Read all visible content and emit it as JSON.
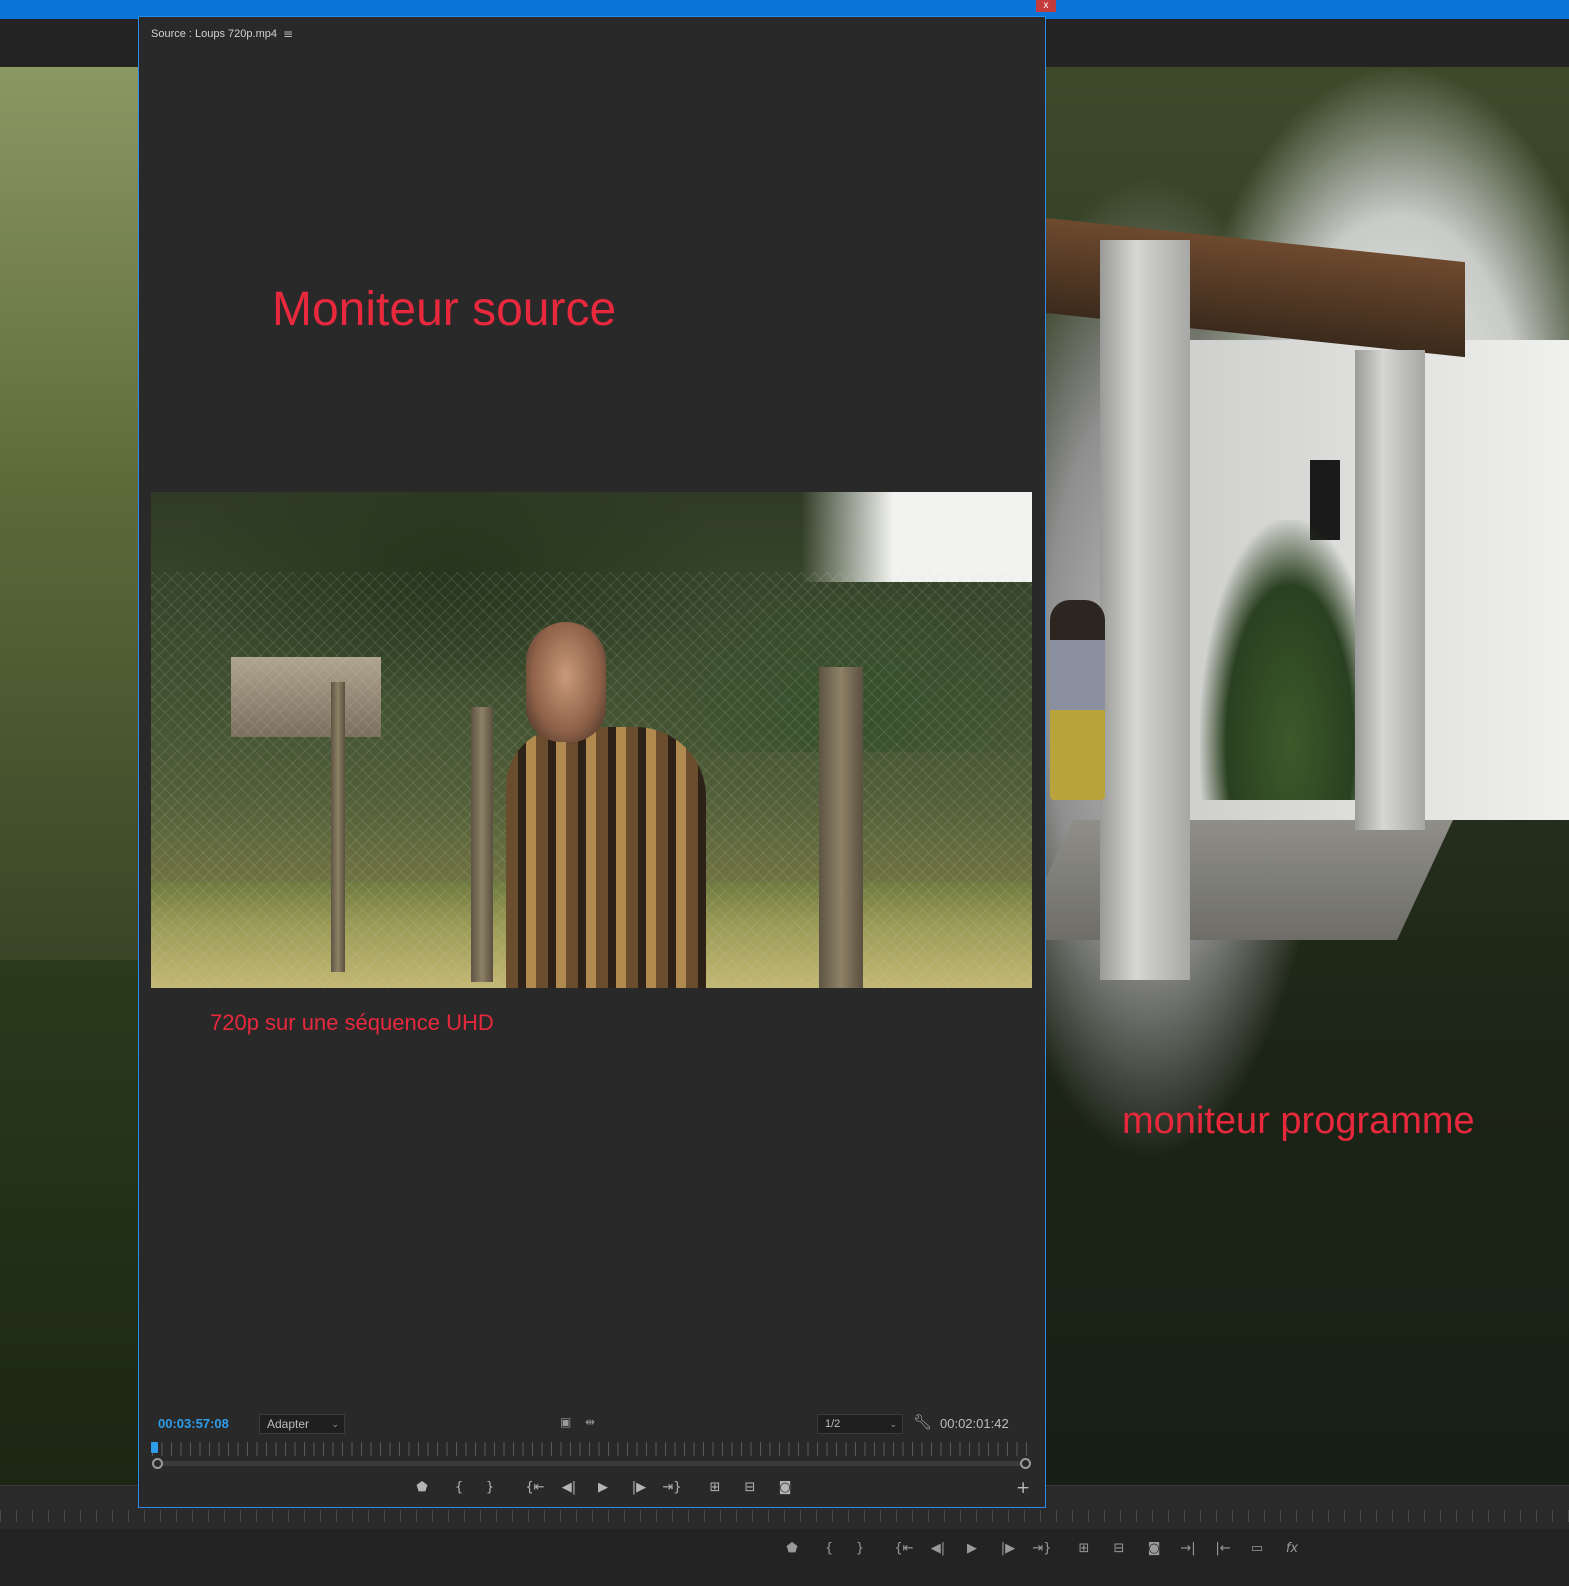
{
  "window": {
    "close_label": "x"
  },
  "source_monitor": {
    "tab_title": "Source : Loups 720p.mp4",
    "menu_icon": "hamburger-icon",
    "overlay_title": "Moniteur source",
    "overlay_caption": "720p sur une séquence UHD",
    "timecode": "00:03:57:08",
    "fit_select": {
      "value": "Adapter"
    },
    "resolution_select": {
      "value": "1/2"
    },
    "duration": "00:02:01:42",
    "playhead_position": 0.0,
    "transport": [
      {
        "icon": "marker-icon",
        "glyph": "⬟"
      },
      {
        "icon": "mark-in-icon",
        "glyph": "{"
      },
      {
        "icon": "mark-out-icon",
        "glyph": "}"
      },
      {
        "icon": "go-to-in-icon",
        "glyph": "{⇤"
      },
      {
        "icon": "step-back-icon",
        "glyph": "◀|"
      },
      {
        "icon": "play-icon",
        "glyph": "▶"
      },
      {
        "icon": "step-forward-icon",
        "glyph": "|▶"
      },
      {
        "icon": "go-to-out-icon",
        "glyph": "⇥}"
      },
      {
        "icon": "insert-icon",
        "glyph": "⊞"
      },
      {
        "icon": "overwrite-icon",
        "glyph": "⊟"
      },
      {
        "icon": "export-frame-icon",
        "glyph": "◙"
      }
    ],
    "add_button": "+"
  },
  "program_monitor": {
    "overlay_label": "moniteur programme",
    "transport": [
      {
        "icon": "marker-icon",
        "glyph": "⬟"
      },
      {
        "icon": "mark-in-icon",
        "glyph": "{"
      },
      {
        "icon": "mark-out-icon",
        "glyph": "}"
      },
      {
        "icon": "go-to-in-icon",
        "glyph": "{⇤"
      },
      {
        "icon": "step-back-icon",
        "glyph": "◀|"
      },
      {
        "icon": "play-icon",
        "glyph": "▶"
      },
      {
        "icon": "step-forward-icon",
        "glyph": "|▶"
      },
      {
        "icon": "go-to-out-icon",
        "glyph": "⇥}"
      },
      {
        "icon": "lift-icon",
        "glyph": "⊞"
      },
      {
        "icon": "extract-icon",
        "glyph": "⊟"
      },
      {
        "icon": "export-frame-icon",
        "glyph": "◙"
      },
      {
        "icon": "next-edit-icon",
        "glyph": "→|"
      },
      {
        "icon": "previous-edit-icon",
        "glyph": "|←"
      },
      {
        "icon": "comparison-view-icon",
        "glyph": "▭"
      },
      {
        "icon": "fx-icon",
        "glyph": "fx"
      }
    ]
  },
  "colors": {
    "accent": "#2d9ce9",
    "annotation_red": "#e8283c",
    "panel_bg": "#292929",
    "title_bar": "#0a74d8"
  }
}
